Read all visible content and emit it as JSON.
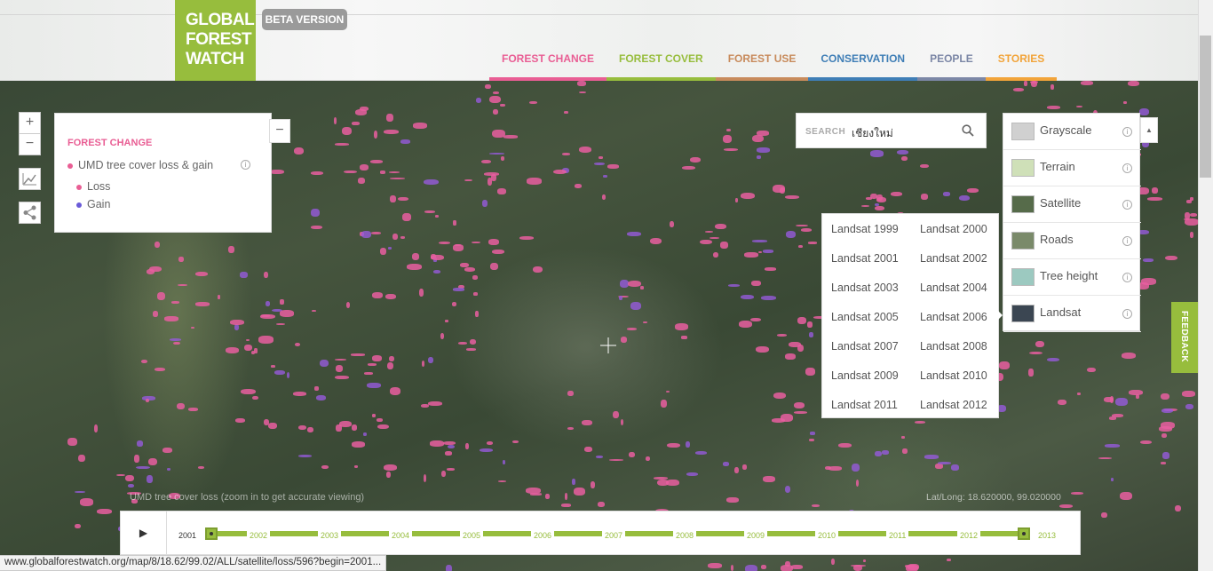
{
  "header": {
    "logo_lines": [
      "GLOBAL",
      "FOREST",
      "WATCH"
    ],
    "beta_label": "BETA VERSION",
    "nav": [
      {
        "label": "FOREST CHANGE",
        "color": "#e95e94"
      },
      {
        "label": "FOREST COVER",
        "color": "#97bd3d"
      },
      {
        "label": "FOREST USE",
        "color": "#c88b5c"
      },
      {
        "label": "CONSERVATION",
        "color": "#3f7eb6"
      },
      {
        "label": "PEOPLE",
        "color": "#7c87a6"
      },
      {
        "label": "STORIES",
        "color": "#f2a43a"
      }
    ]
  },
  "map_controls": {
    "zoom_in": "+",
    "zoom_out": "−"
  },
  "legend": {
    "title": "FOREST CHANGE",
    "layer": "UMD tree cover loss & gain",
    "items": [
      {
        "label": "Loss",
        "color": "#e95e94"
      },
      {
        "label": "Gain",
        "color": "#6a5bd8"
      }
    ],
    "close": "−"
  },
  "search": {
    "label": "SEARCH",
    "value": "เชียงใหม่"
  },
  "basemaps": [
    {
      "label": "Grayscale",
      "color": "#d0d0d0"
    },
    {
      "label": "Terrain",
      "color": "#cfe0b8"
    },
    {
      "label": "Satellite",
      "color": "#566b4a"
    },
    {
      "label": "Roads",
      "color": "#7a8a6a"
    },
    {
      "label": "Tree height",
      "color": "#9cc9c0"
    },
    {
      "label": "Landsat",
      "color": "#3b4652"
    }
  ],
  "landsat_years": [
    "Landsat 1999",
    "Landsat 2000",
    "Landsat 2001",
    "Landsat 2002",
    "Landsat 2003",
    "Landsat 2004",
    "Landsat 2005",
    "Landsat 2006",
    "Landsat 2007",
    "Landsat 2008",
    "Landsat 2009",
    "Landsat 2010",
    "Landsat 2011",
    "Landsat 2012"
  ],
  "feedback_label": "FEEDBACK",
  "map_caption": "UMD tree cover loss (zoom in to get accurate viewing)",
  "latlng": "Lat/Long: 18.620000, 99.020000",
  "timeline": {
    "years": [
      "2001",
      "2002",
      "2003",
      "2004",
      "2005",
      "2006",
      "2007",
      "2008",
      "2009",
      "2010",
      "2011",
      "2012",
      "2013"
    ],
    "start": "2001",
    "end": "2013"
  },
  "status_url": "www.globalforestwatch.org/map/8/18.62/99.02/ALL/satellite/loss/596?begin=2001..."
}
